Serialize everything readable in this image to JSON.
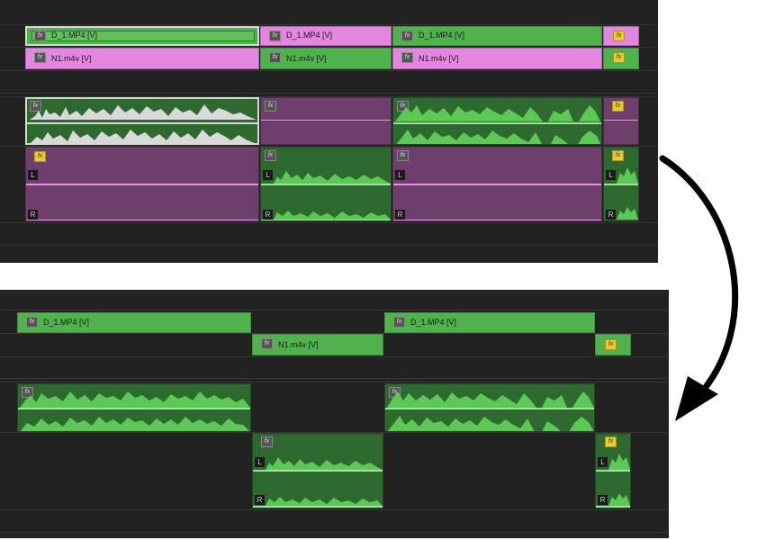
{
  "top": {
    "video_clips": [
      {
        "track": "v2",
        "name": "D_1.MP4 [V]",
        "fx_icon": "fx",
        "color": "green",
        "selected": true
      },
      {
        "track": "v2",
        "name": "D_1.MP4 [V]",
        "fx_icon": "fx",
        "color": "pink"
      },
      {
        "track": "v2",
        "name": "D_1.MP4 [V]",
        "fx_icon": "fx",
        "color": "green"
      },
      {
        "track": "v2",
        "name": "",
        "fx_icon": "fx",
        "color": "pink",
        "fx_yellow": true
      },
      {
        "track": "v1",
        "name": "N1.m4v [V]",
        "fx_icon": "fx",
        "color": "pink"
      },
      {
        "track": "v1",
        "name": "N1.m4v [V]",
        "fx_icon": "fx",
        "color": "green"
      },
      {
        "track": "v1",
        "name": "N1.m4v [V]",
        "fx_icon": "fx",
        "color": "pink"
      },
      {
        "track": "v1",
        "name": "",
        "fx_icon": "fx",
        "color": "green",
        "fx_yellow": true
      }
    ],
    "audio_labels": {
      "left": "L",
      "right": "R"
    }
  },
  "bottom": {
    "video_clips": [
      {
        "name": "D_1.MP4 [V]",
        "fx_icon": "fx"
      },
      {
        "name": "N1.m4v [V]",
        "fx_icon": "fx"
      },
      {
        "name": "D_1.MP4 [V]",
        "fx_icon": "fx"
      },
      {
        "name": "",
        "fx_icon": "fx",
        "fx_yellow": true
      }
    ],
    "audio_labels": {
      "left": "L",
      "right": "R"
    }
  },
  "arrow": {
    "icon": "curved-arrow-down-icon",
    "color": "#000000"
  },
  "colors": {
    "panel_bg": "#222222",
    "video_green": "#4fb24c",
    "video_pink": "#e286e0",
    "audio_green": "#2e6a2f",
    "audio_purple": "#6e3e6c",
    "fx_yellow": "#e7c93a"
  }
}
